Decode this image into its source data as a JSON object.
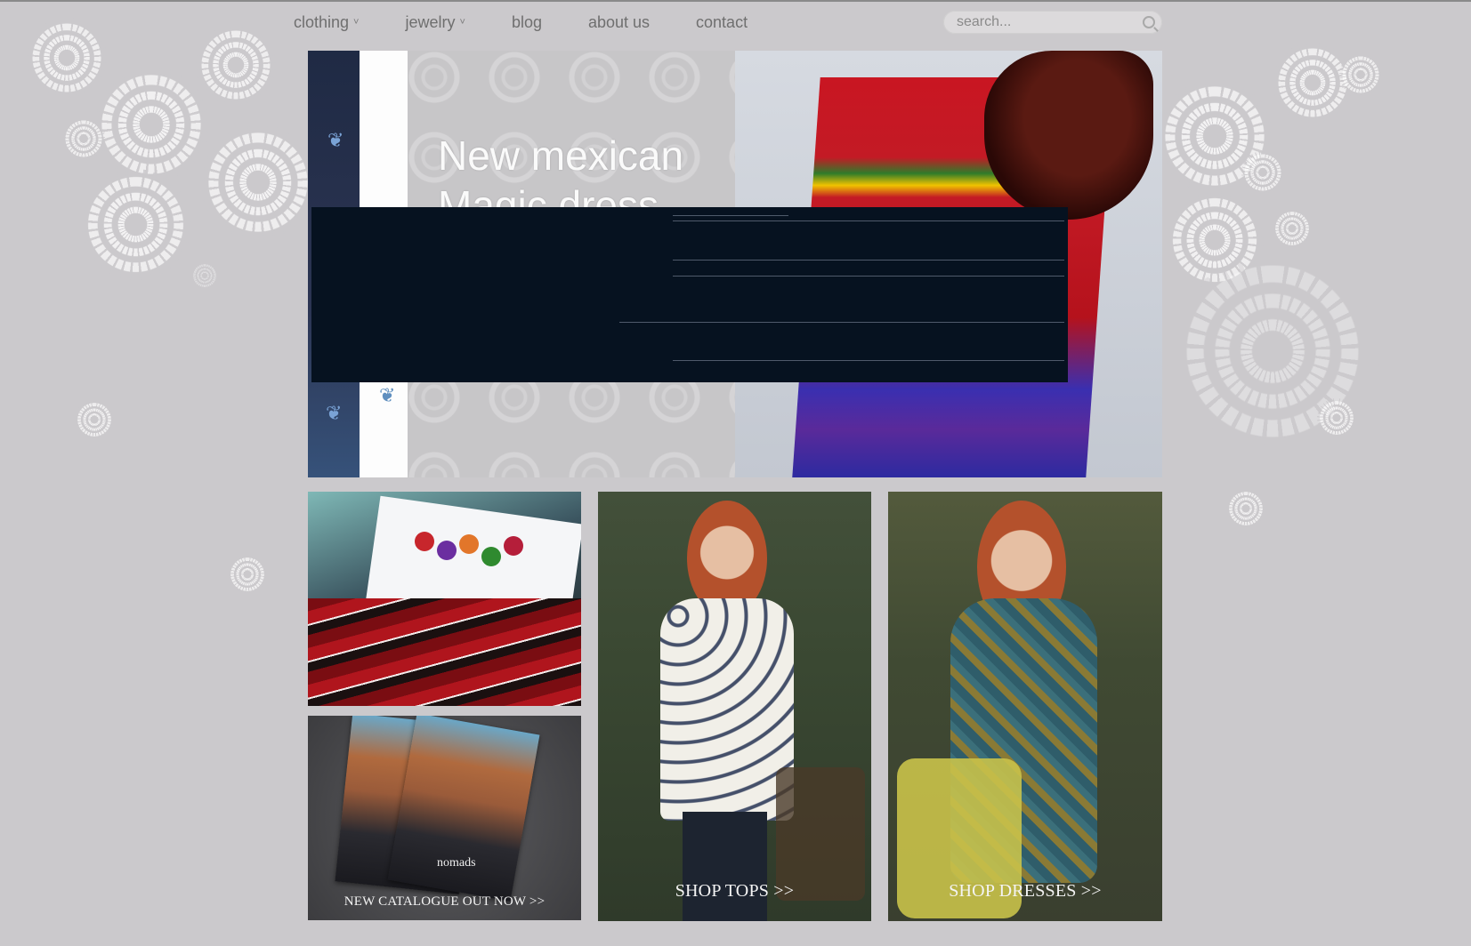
{
  "nav": {
    "items": [
      {
        "label": "clothing",
        "has_dropdown": true
      },
      {
        "label": "jewelry",
        "has_dropdown": true
      },
      {
        "label": "blog",
        "has_dropdown": false
      },
      {
        "label": "about us",
        "has_dropdown": false
      },
      {
        "label": "contact",
        "has_dropdown": false
      }
    ],
    "dropdown_glyph": "˅"
  },
  "search": {
    "placeholder": "search...",
    "icon": "magnifier-icon"
  },
  "hero": {
    "title": "New mexican\nMagic dress"
  },
  "tiles": {
    "catalogue_label": "NEW CATALOGUE OUT NOW >>",
    "catalogue_card_text": "nomads",
    "tops_label": "SHOP TOPS >>",
    "dresses_label": "SHOP DRESSES >>"
  },
  "colors": {
    "background": "#cbc9cc",
    "nav_text": "#6f6f6f",
    "overlay": "#061220"
  }
}
